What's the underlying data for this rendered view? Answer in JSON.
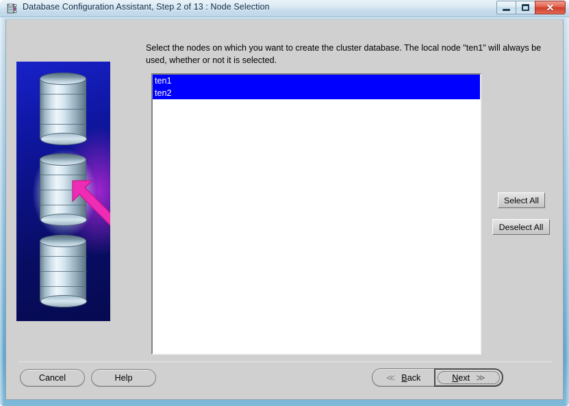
{
  "window": {
    "title": "Database Configuration Assistant, Step 2 of 13 : Node Selection",
    "icon": "database-app-icon",
    "controls": {
      "minimize": "minimize-icon",
      "maximize": "maximize-icon",
      "close": "✕"
    }
  },
  "main": {
    "instructions": "Select the nodes on which you want to create the cluster database. The local node \"ten1\" will always be used, whether or not it is selected.",
    "node_list": [
      {
        "label": "ten1",
        "selected": true
      },
      {
        "label": "ten2",
        "selected": true
      }
    ],
    "side_buttons": {
      "select_all": "Select All",
      "deselect_all": "Deselect All"
    },
    "sidebar_art": {
      "alt": "Oracle database cylinders with magenta arrow",
      "cylinders": 3,
      "highlighted_cylinder": 2
    }
  },
  "footer": {
    "cancel": "Cancel",
    "help": "Help",
    "back": {
      "label_prefix": "B",
      "label_rest": "ack",
      "chevron": "≪"
    },
    "next": {
      "label_prefix": "N",
      "label_rest": "ext",
      "chevron": "≫"
    }
  },
  "colors": {
    "selection_blue": "#0000ff",
    "panel_grey": "#d0d0d0",
    "art_blue": "#0b1182",
    "art_magenta": "#ba28dc",
    "arrow_pink": "#ee2cb4",
    "title_text": "#0b2a47"
  }
}
